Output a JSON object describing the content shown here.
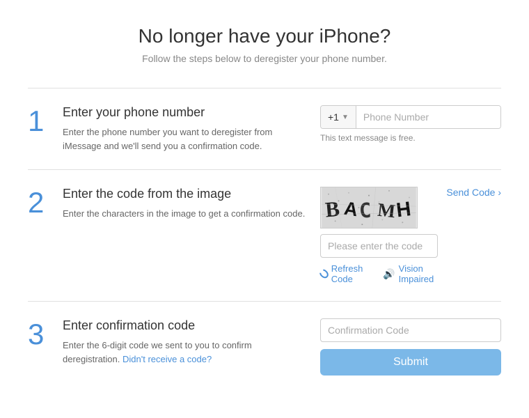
{
  "header": {
    "title": "No longer have your iPhone?",
    "subtitle": "Follow the steps below to deregister your phone number."
  },
  "steps": [
    {
      "number": "1",
      "title": "Enter your phone number",
      "desc": "Enter the phone number you want to deregister from iMessage and we'll send you a confirmation code.",
      "input": {
        "country_code": "+1",
        "placeholder": "Phone Number",
        "free_msg": "This text message is free."
      }
    },
    {
      "number": "2",
      "title": "Enter the code from the image",
      "desc": "Enter the characters in the image to get a confirmation code.",
      "captcha_text": "BACMH",
      "code_placeholder": "Please enter the code",
      "send_code_label": "Send Code ›",
      "refresh_label": "Refresh Code",
      "vision_label": "Vision Impaired"
    },
    {
      "number": "3",
      "title": "Enter confirmation code",
      "desc": "Enter the 6-digit code we sent to you to confirm deregistration.",
      "link_text": "Didn't receive a code?",
      "confirmation_placeholder": "Confirmation Code",
      "submit_label": "Submit"
    }
  ]
}
